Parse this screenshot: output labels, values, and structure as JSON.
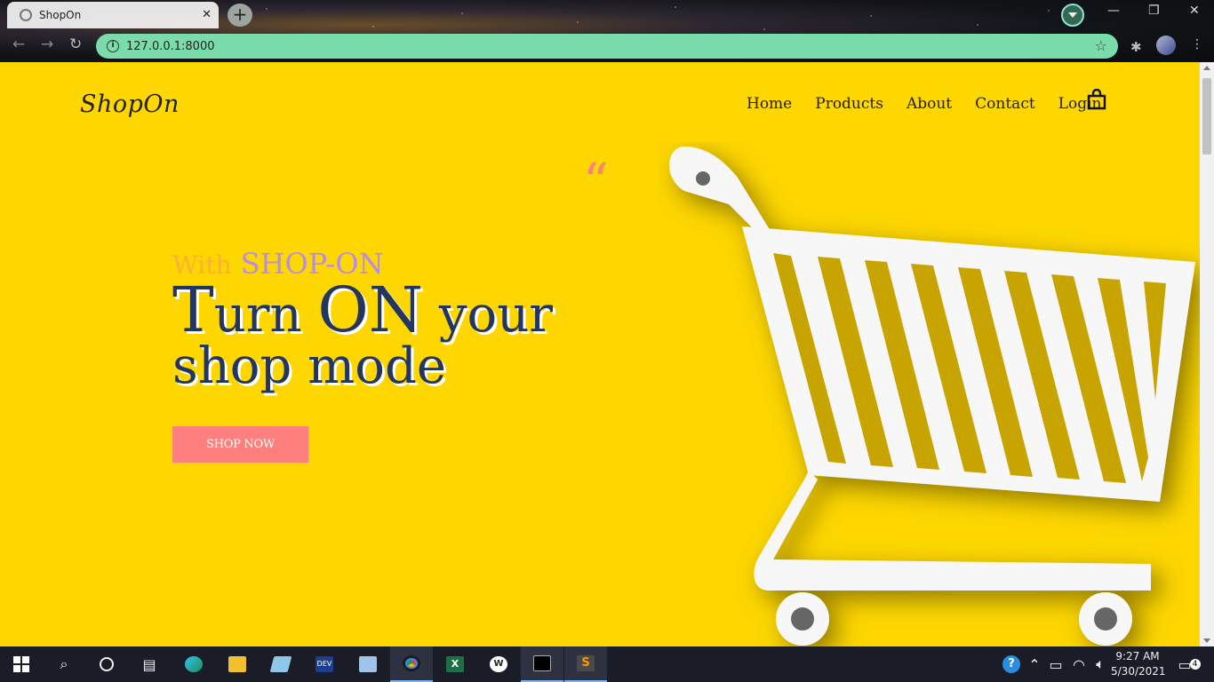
{
  "browser": {
    "tab_title": "ShopOn",
    "new_tab": "+",
    "close": "✕",
    "url": "127.0.0.1:8000"
  },
  "site": {
    "brand": "ShopOn",
    "nav": [
      "Home",
      "Products",
      "About",
      "Contact",
      "Login"
    ],
    "quote_mark": "“",
    "tagline_with": "With",
    "tagline_brand": "SHOP-ON",
    "headline_line1_a": "T",
    "headline_line1_b": "urn ",
    "headline_line1_c": "ON",
    "headline_line1_d": " your",
    "headline_line2": "shop mode",
    "cta": "SHOP NOW",
    "accent_color": "#fed700",
    "button_color": "#ff7f7f"
  },
  "taskbar": {
    "time": "9:27 AM",
    "date": "5/30/2021",
    "notifications": "4"
  }
}
